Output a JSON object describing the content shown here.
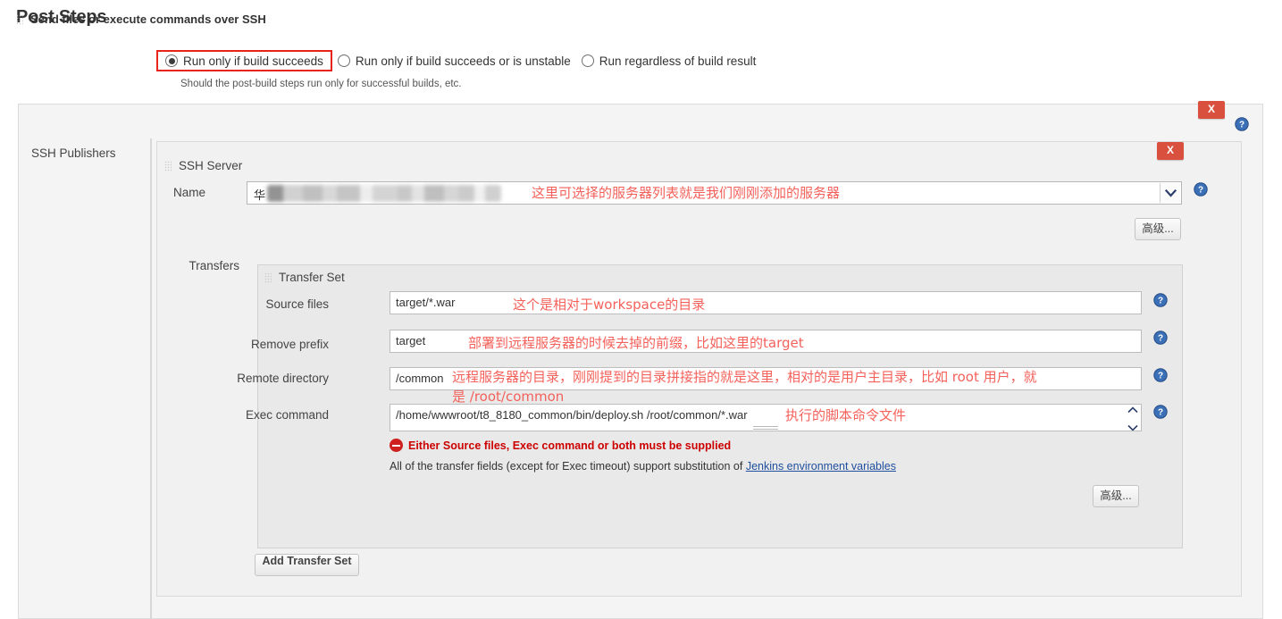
{
  "page": {
    "title": "Post Steps"
  },
  "build_trigger": {
    "options": [
      {
        "label": "Run only if build succeeds",
        "selected": true,
        "highlighted": true
      },
      {
        "label": "Run only if build succeeds or is unstable",
        "selected": false,
        "highlighted": false
      },
      {
        "label": "Run regardless of build result",
        "selected": false,
        "highlighted": false
      }
    ],
    "help_text": "Should the post-build steps run only for successful builds, etc."
  },
  "publisher_panel": {
    "title": "Send files or execute commands over SSH",
    "delete_label": "X",
    "help_icon": "help-icon",
    "sidebar_label": "SSH Publishers"
  },
  "ssh_server": {
    "title": "SSH Server",
    "delete_label": "X",
    "name_label": "Name",
    "name_value": "华",
    "name_value_redacted": true,
    "advanced_button": "高级...",
    "transfers_label": "Transfers"
  },
  "transfer_set": {
    "title": "Transfer Set",
    "fields": [
      {
        "label": "Source files",
        "value": "target/*.war"
      },
      {
        "label": "Remove prefix",
        "value": "target"
      },
      {
        "label": "Remote directory",
        "value": "/common"
      },
      {
        "label": "Exec command",
        "value": "/home/wwwroot/t8_8180_common/bin/deploy.sh /root/common/*.war"
      }
    ],
    "error_message": "Either Source files, Exec command or both must be supplied",
    "note_prefix": "All of the transfer fields (except for Exec timeout) support substitution of ",
    "note_link": "Jenkins environment variables",
    "advanced_button": "高级...",
    "add_transfer_set_button": "Add Transfer Set"
  },
  "annotations": [
    {
      "id": "name",
      "text": "这里可选择的服务器列表就是我们刚刚添加的服务器"
    },
    {
      "id": "source_files",
      "text": "这个是相对于workspace的目录"
    },
    {
      "id": "remove_prefix",
      "text": "部署到远程服务器的时候去掉的前缀，比如这里的target"
    },
    {
      "id": "remote_dir_line1",
      "text": "远程服务器的目录，刚刚提到的目录拼接指的就是这里，相对的是用户主目录，比如 root 用户，就"
    },
    {
      "id": "remote_dir_line2",
      "text": "是 /root/common"
    },
    {
      "id": "exec_command",
      "text": "执行的脚本命令文件"
    }
  ],
  "colors": {
    "annotation_red": "#f4615a",
    "highlight_border": "#e8231a",
    "delete_button": "#d9503f",
    "error_red": "#cc0000",
    "link_blue": "#1f4f9e"
  }
}
